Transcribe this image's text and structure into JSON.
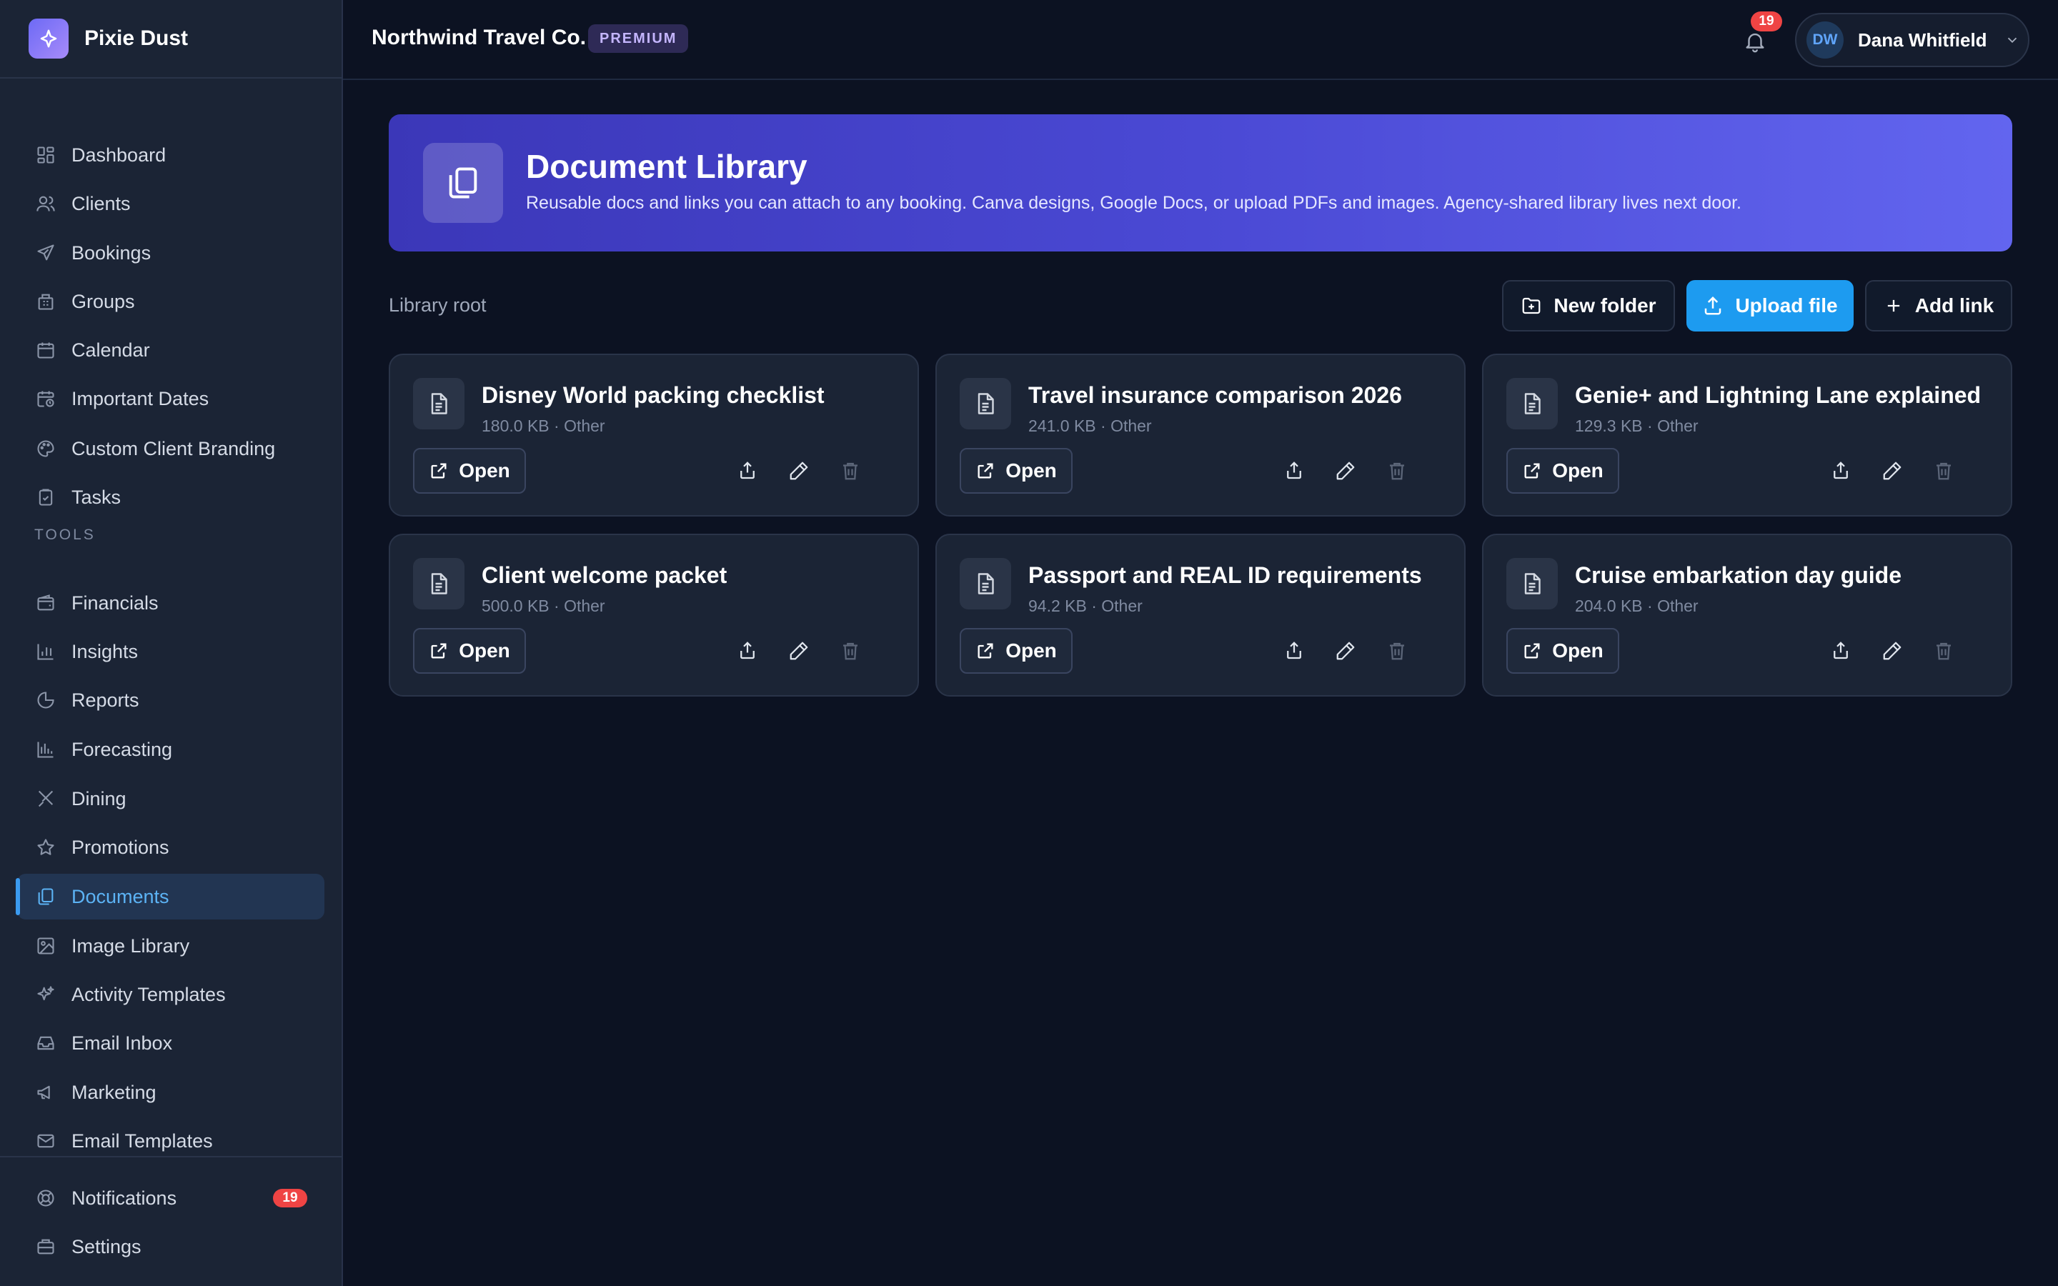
{
  "brand": {
    "name": "Pixie Dust",
    "logo_icon": "sparkles-icon",
    "logo_color": "#6d6af5"
  },
  "header": {
    "org_name": "Northwind Travel Co.",
    "tier_badge": "PREMIUM",
    "notification_count": "19",
    "user": {
      "initials": "DW",
      "name": "Dana Whitfield"
    }
  },
  "sidebar": {
    "main": [
      {
        "label": "Dashboard",
        "icon": "dashboard-icon"
      },
      {
        "label": "Clients",
        "icon": "users-icon"
      },
      {
        "label": "Bookings",
        "icon": "plane-icon"
      },
      {
        "label": "Groups",
        "icon": "building-icon"
      },
      {
        "label": "Calendar",
        "icon": "calendar-icon"
      },
      {
        "label": "Important Dates",
        "icon": "calendar-clock-icon"
      },
      {
        "label": "Custom Client Branding",
        "icon": "palette-icon"
      },
      {
        "label": "Tasks",
        "icon": "clipboard-check-icon"
      }
    ],
    "tools_label": "TOOLS",
    "tools": [
      {
        "label": "Financials",
        "icon": "wallet-icon"
      },
      {
        "label": "Insights",
        "icon": "bar-chart-icon"
      },
      {
        "label": "Reports",
        "icon": "pie-chart-icon"
      },
      {
        "label": "Forecasting",
        "icon": "chart-columns-icon"
      },
      {
        "label": "Dining",
        "icon": "utensils-icon"
      },
      {
        "label": "Promotions",
        "icon": "star-icon"
      },
      {
        "label": "Documents",
        "icon": "files-icon",
        "active": true
      },
      {
        "label": "Image Library",
        "icon": "image-icon"
      },
      {
        "label": "Activity Templates",
        "icon": "sparkles-icon"
      },
      {
        "label": "Email Inbox",
        "icon": "inbox-icon"
      },
      {
        "label": "Marketing",
        "icon": "megaphone-icon"
      },
      {
        "label": "Email Templates",
        "icon": "mail-icon"
      }
    ],
    "bottom": [
      {
        "label": "Notifications",
        "icon": "lifebuoy-icon",
        "badge": "19"
      },
      {
        "label": "Settings",
        "icon": "briefcase-icon"
      }
    ]
  },
  "hero": {
    "title": "Document Library",
    "description": "Reusable docs and links you can attach to any booking. Canva designs, Google Docs, or upload PDFs and images. Agency-shared library lives next door.",
    "gradient_start": "#3b37b8",
    "gradient_end": "#6265ef"
  },
  "toolbar": {
    "breadcrumb": "Library root",
    "new_folder": "New folder",
    "upload_file": "Upload file",
    "add_link": "Add link",
    "accent": "#1d9bf0"
  },
  "documents": [
    {
      "title": "Disney World packing checklist",
      "meta": "180.0 KB · Other",
      "open_label": "Open"
    },
    {
      "title": "Travel insurance comparison 2026",
      "meta": "241.0 KB · Other",
      "open_label": "Open"
    },
    {
      "title": "Genie+ and Lightning Lane explained",
      "meta": "129.3 KB · Other",
      "open_label": "Open"
    },
    {
      "title": "Client welcome packet",
      "meta": "500.0 KB · Other",
      "open_label": "Open"
    },
    {
      "title": "Passport and REAL ID requirements",
      "meta": "94.2 KB · Other",
      "open_label": "Open"
    },
    {
      "title": "Cruise embarkation day guide",
      "meta": "204.0 KB · Other",
      "open_label": "Open"
    }
  ]
}
